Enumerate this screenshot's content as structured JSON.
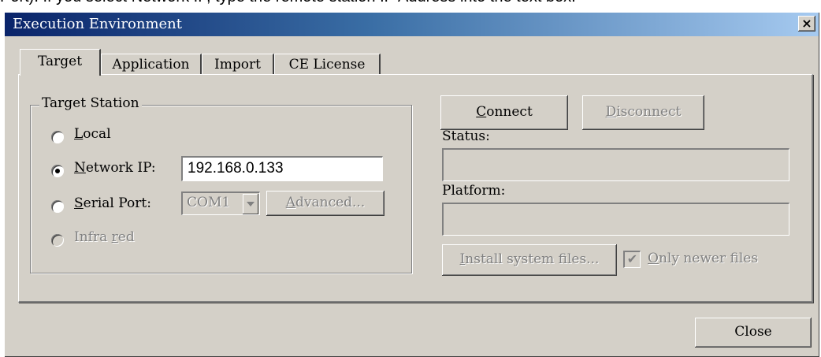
{
  "doc_header": {
    "text": "Port). If you select Network IP, type the remote station IP Address into the text box."
  },
  "window": {
    "title": "Execution Environment",
    "close_glyph": "×"
  },
  "tabs": [
    {
      "label": "Target",
      "active": true
    },
    {
      "label": "Application",
      "active": false
    },
    {
      "label": "Import",
      "active": false
    },
    {
      "label": "CE License",
      "active": false
    }
  ],
  "target_station": {
    "legend": "Target Station",
    "local": {
      "label_mn": "L",
      "label_rest": "ocal",
      "selected": false
    },
    "network_ip": {
      "label_mn": "N",
      "label_rest": "etwork IP:",
      "selected": true,
      "value": "192.168.0.133"
    },
    "serial_port": {
      "label_mn": "S",
      "label_rest": "erial Port:",
      "selected": false,
      "combo_value": "COM1",
      "advanced_label_mn": "A",
      "advanced_label_rest": "dvanced..."
    },
    "infra_red": {
      "label_pre": "Infra ",
      "label_mn": "r",
      "label_rest": "ed",
      "enabled": false
    }
  },
  "connection": {
    "connect_mn": "C",
    "connect_rest": "onnect",
    "disconnect_mn": "D",
    "disconnect_rest": "isconnect",
    "status_label": "Status:",
    "status_value": "",
    "platform_label": "Platform:",
    "platform_value": "",
    "install_mn": "I",
    "install_rest": "nstall system files...",
    "only_newer_mn": "O",
    "only_newer_rest": "nly newer files",
    "only_newer_checked": true,
    "check_glyph": "✔"
  },
  "footer": {
    "close_label": "Close"
  },
  "icons": {
    "close": "close-icon",
    "dropdown": "chevron-down-icon"
  }
}
